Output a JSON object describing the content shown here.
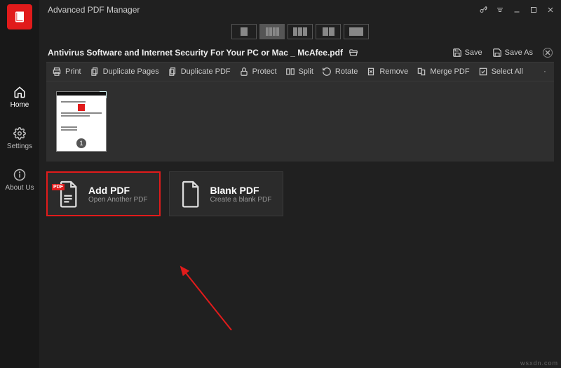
{
  "app": {
    "title": "Advanced PDF Manager"
  },
  "rail": {
    "home": "Home",
    "settings": "Settings",
    "about": "About Us"
  },
  "document": {
    "name": "Antivirus Software and Internet Security For Your PC or Mac _ McAfee.pdf",
    "save": "Save",
    "save_as": "Save As",
    "page_badge": "1"
  },
  "toolbar": {
    "print": "Print",
    "duplicate_pages": "Duplicate Pages",
    "duplicate_pdf": "Duplicate PDF",
    "protect": "Protect",
    "split": "Split",
    "rotate": "Rotate",
    "remove": "Remove",
    "merge": "Merge PDF",
    "select_all": "Select All"
  },
  "cards": {
    "add_title": "Add PDF",
    "add_sub": "Open Another PDF",
    "blank_title": "Blank PDF",
    "blank_sub": "Create a blank PDF",
    "pdf_badge": "PDF"
  },
  "watermark": "wsxdn.com"
}
